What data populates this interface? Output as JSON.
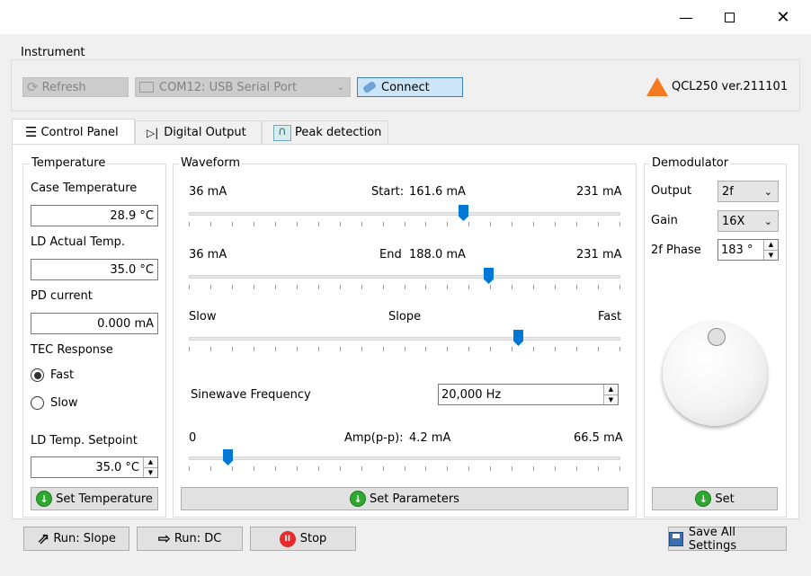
{
  "window": {
    "minimize_icon": "minimize-icon",
    "maximize_icon": "maximize-icon",
    "close_icon": "close-icon"
  },
  "instrument": {
    "title": "Instrument",
    "refresh_label": "Refresh",
    "port_value": "COM12: USB Serial Port",
    "connect_label": "Connect",
    "device_label": "QCL250 ver.211101"
  },
  "tabs": [
    {
      "label": "Control Panel",
      "icon": "sliders-icon"
    },
    {
      "label": "Digital Output",
      "icon": "diode-icon"
    },
    {
      "label": "Peak detection",
      "icon": "peak-icon"
    }
  ],
  "temperature": {
    "title": "Temperature",
    "case_label": "Case Temperature",
    "case_value": "28.9 °C",
    "ld_label": "LD Actual Temp.",
    "ld_value": "35.0 °C",
    "pd_label": "PD current",
    "pd_value": "0.000 mA",
    "tec_label": "TEC Response",
    "tec_fast": "Fast",
    "tec_slow": "Slow",
    "tec_selected": "Fast",
    "setpoint_label": "LD Temp. Setpoint",
    "setpoint_value": "35.0 °C",
    "set_button": "Set Temperature"
  },
  "waveform": {
    "title": "Waveform",
    "start": {
      "min": "36 mA",
      "label": "Start:",
      "value": "161.6 mA",
      "max": "231 mA",
      "fraction": 0.64
    },
    "end": {
      "min": "36 mA",
      "label": "End",
      "value": "188.0 mA",
      "max": "231 mA",
      "fraction": 0.7
    },
    "slope": {
      "min": "Slow",
      "label": "Slope",
      "max": "Fast",
      "fraction": 0.77
    },
    "sine_label": "Sinewave Frequency",
    "sine_value": "20,000 Hz",
    "amp": {
      "min": "0",
      "label": "Amp(p-p):",
      "value": "4.2 mA",
      "max": "66.5 mA",
      "fraction": 0.08
    },
    "set_button": "Set Parameters"
  },
  "demodulator": {
    "title": "Demodulator",
    "output_label": "Output",
    "output_value": "2f",
    "gain_label": "Gain",
    "gain_value": "16X",
    "phase_label": "2f Phase",
    "phase_value": "183 °",
    "set_button": "Set"
  },
  "bottom": {
    "run_slope": "Run: Slope",
    "run_dc": "Run: DC",
    "stop": "Stop",
    "save": "Save All Settings"
  }
}
